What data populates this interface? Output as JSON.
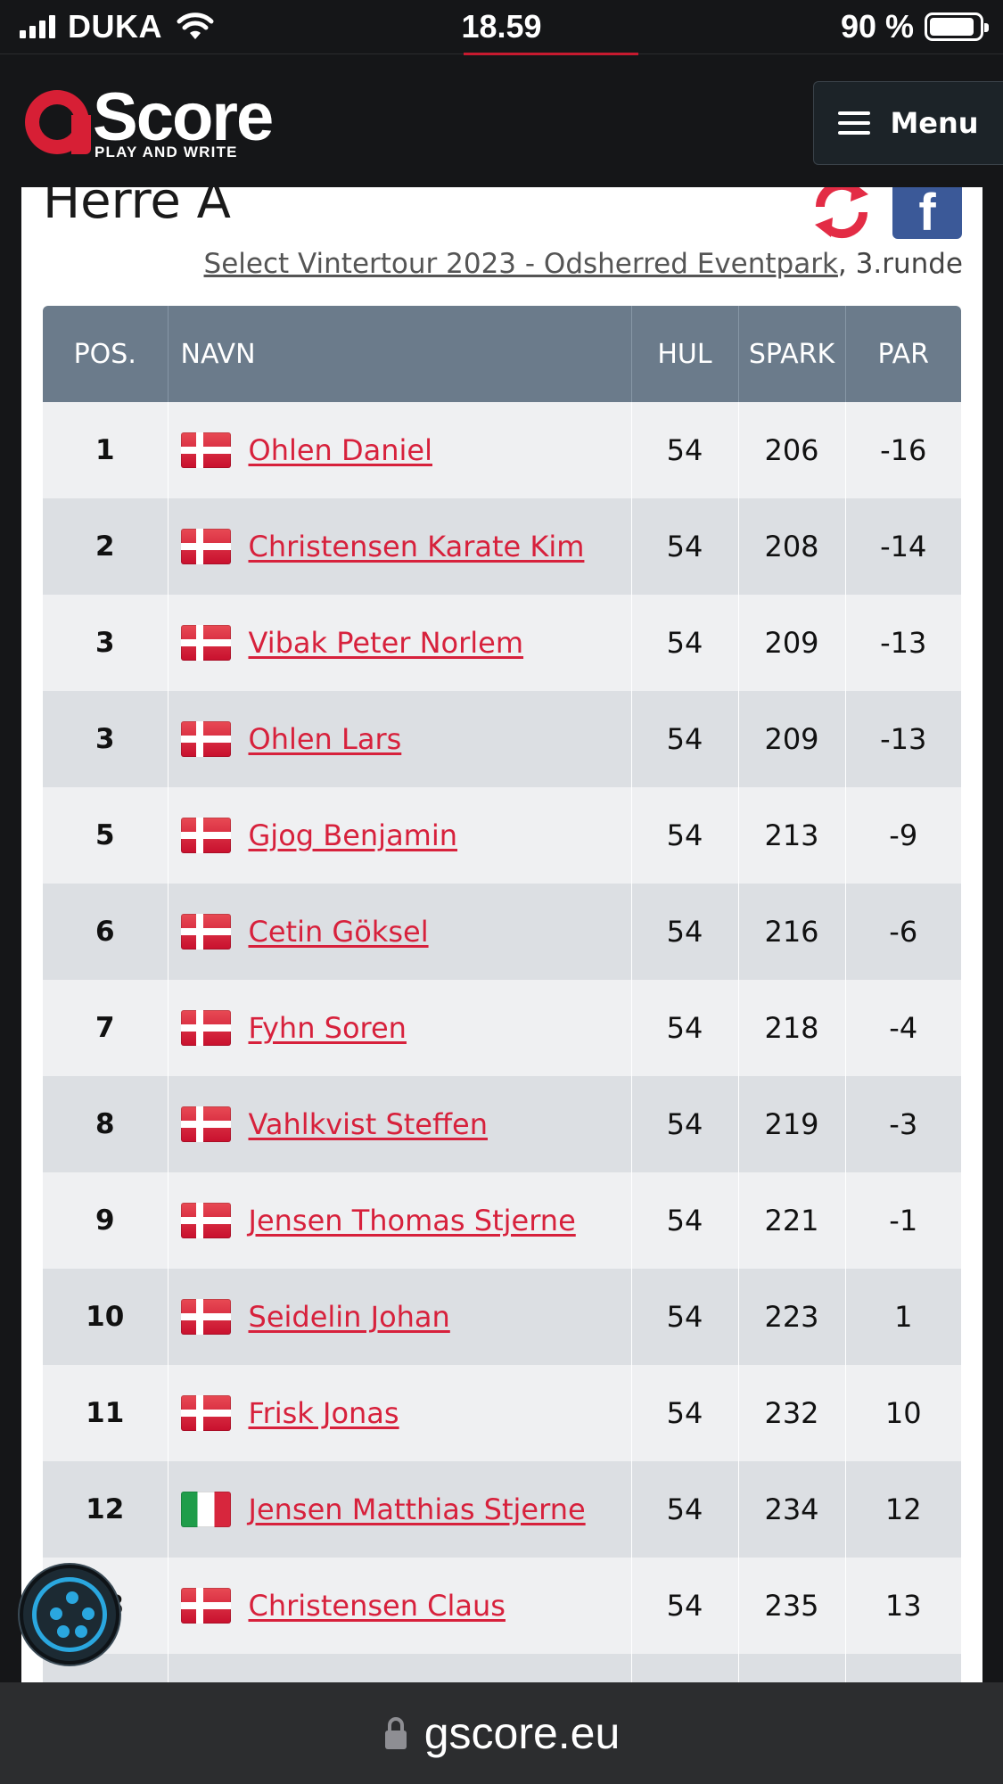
{
  "status_bar": {
    "carrier": "DUKA",
    "time": "18.59",
    "battery": "90 %",
    "battery_level": 0.9
  },
  "header": {
    "logo_text": "Score",
    "logo_tagline": "PLAY AND WRITE",
    "menu_label": "Menu",
    "accent_color": "#d71f35"
  },
  "page": {
    "title": "Herre A",
    "tournament_link": "Select Vintertour 2023 - Odsherred Eventpark",
    "round": ", 3.runde"
  },
  "table": {
    "columns": {
      "pos": "POS.",
      "navn": "NAVN",
      "hul": "HUL",
      "spark": "SPARK",
      "par": "PAR"
    },
    "rows": [
      {
        "pos": "1",
        "flag": "denmark-flag",
        "name": "Ohlen Daniel",
        "hul": "54",
        "spark": "206",
        "par": "-16"
      },
      {
        "pos": "2",
        "flag": "denmark-flag",
        "name": "Christensen Karate Kim",
        "hul": "54",
        "spark": "208",
        "par": "-14"
      },
      {
        "pos": "3",
        "flag": "denmark-flag",
        "name": "Vibak Peter Norlem",
        "hul": "54",
        "spark": "209",
        "par": "-13"
      },
      {
        "pos": "3",
        "flag": "denmark-flag",
        "name": "Ohlen Lars",
        "hul": "54",
        "spark": "209",
        "par": "-13"
      },
      {
        "pos": "5",
        "flag": "denmark-flag",
        "name": "Gjog Benjamin",
        "hul": "54",
        "spark": "213",
        "par": "-9"
      },
      {
        "pos": "6",
        "flag": "denmark-flag",
        "name": "Cetin Göksel",
        "hul": "54",
        "spark": "216",
        "par": "-6"
      },
      {
        "pos": "7",
        "flag": "denmark-flag",
        "name": "Fyhn Soren",
        "hul": "54",
        "spark": "218",
        "par": "-4"
      },
      {
        "pos": "8",
        "flag": "denmark-flag",
        "name": "Vahlkvist Steffen",
        "hul": "54",
        "spark": "219",
        "par": "-3"
      },
      {
        "pos": "9",
        "flag": "denmark-flag",
        "name": "Jensen Thomas Stjerne",
        "hul": "54",
        "spark": "221",
        "par": "-1"
      },
      {
        "pos": "10",
        "flag": "denmark-flag",
        "name": "Seidelin Johan",
        "hul": "54",
        "spark": "223",
        "par": "1"
      },
      {
        "pos": "11",
        "flag": "denmark-flag",
        "name": "Frisk Jonas",
        "hul": "54",
        "spark": "232",
        "par": "10"
      },
      {
        "pos": "12",
        "flag": "italy-flag",
        "name": "Jensen Matthias Stjerne",
        "hul": "54",
        "spark": "234",
        "par": "12"
      },
      {
        "pos": "13",
        "flag": "denmark-flag",
        "name": "Christensen Claus",
        "hul": "54",
        "spark": "235",
        "par": "13"
      },
      {
        "pos": "",
        "flag": "",
        "name": "",
        "hul": "",
        "spark": "",
        "par": ""
      }
    ],
    "colors": {
      "header_bg": "#6b7b8b",
      "row_odd": "#eff0f2",
      "row_even": "#dcdfe3",
      "name_link": "#d7213c",
      "par_under": "#4aaa19",
      "par_over": "#d7213c"
    }
  },
  "url_bar": {
    "url": "gscore.eu"
  },
  "icons": [
    "wifi-icon",
    "refresh-icon",
    "facebook-icon",
    "hamburger-icon",
    "accessibility-icon",
    "lock-icon"
  ]
}
